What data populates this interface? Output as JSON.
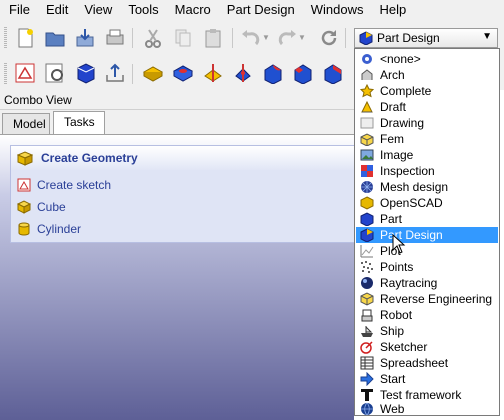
{
  "menubar": {
    "items": [
      "File",
      "Edit",
      "View",
      "Tools",
      "Macro",
      "Part Design",
      "Windows",
      "Help"
    ]
  },
  "workbench_selector": {
    "value": "Part Design",
    "icon": "part-design-icon"
  },
  "combo_view": {
    "title": "Combo View",
    "tabs": [
      "Model",
      "Tasks"
    ],
    "active_tab": "Tasks"
  },
  "task_panel": {
    "header": "Create Geometry",
    "links": [
      "Create sketch",
      "Cube",
      "Cylinder"
    ]
  },
  "dropdown": {
    "selected": "Part Design",
    "items": [
      {
        "label": "<none>",
        "icon": "none-icon"
      },
      {
        "label": "Arch",
        "icon": "arch-icon"
      },
      {
        "label": "Complete",
        "icon": "star-icon"
      },
      {
        "label": "Draft",
        "icon": "draft-icon"
      },
      {
        "label": "Drawing",
        "icon": "drawing-icon"
      },
      {
        "label": "Fem",
        "icon": "fem-icon"
      },
      {
        "label": "Image",
        "icon": "image-icon"
      },
      {
        "label": "Inspection",
        "icon": "inspection-icon"
      },
      {
        "label": "Mesh design",
        "icon": "mesh-icon"
      },
      {
        "label": "OpenSCAD",
        "icon": "openscad-icon"
      },
      {
        "label": "Part",
        "icon": "part-icon"
      },
      {
        "label": "Part Design",
        "icon": "part-design-icon"
      },
      {
        "label": "Plot",
        "icon": "plot-icon"
      },
      {
        "label": "Points",
        "icon": "points-icon"
      },
      {
        "label": "Raytracing",
        "icon": "raytracing-icon"
      },
      {
        "label": "Reverse Engineering",
        "icon": "reverse-engineering-icon"
      },
      {
        "label": "Robot",
        "icon": "robot-icon"
      },
      {
        "label": "Ship",
        "icon": "ship-icon"
      },
      {
        "label": "Sketcher",
        "icon": "sketcher-icon"
      },
      {
        "label": "Spreadsheet",
        "icon": "spreadsheet-icon"
      },
      {
        "label": "Start",
        "icon": "start-arrow-icon"
      },
      {
        "label": "Test framework",
        "icon": "test-framework-icon"
      },
      {
        "label": "Web",
        "icon": "web-globe-icon"
      }
    ]
  },
  "colors": {
    "selection": "#3399ff",
    "task_link": "#2a3f97",
    "panel_bottom": "#5d5f96"
  }
}
